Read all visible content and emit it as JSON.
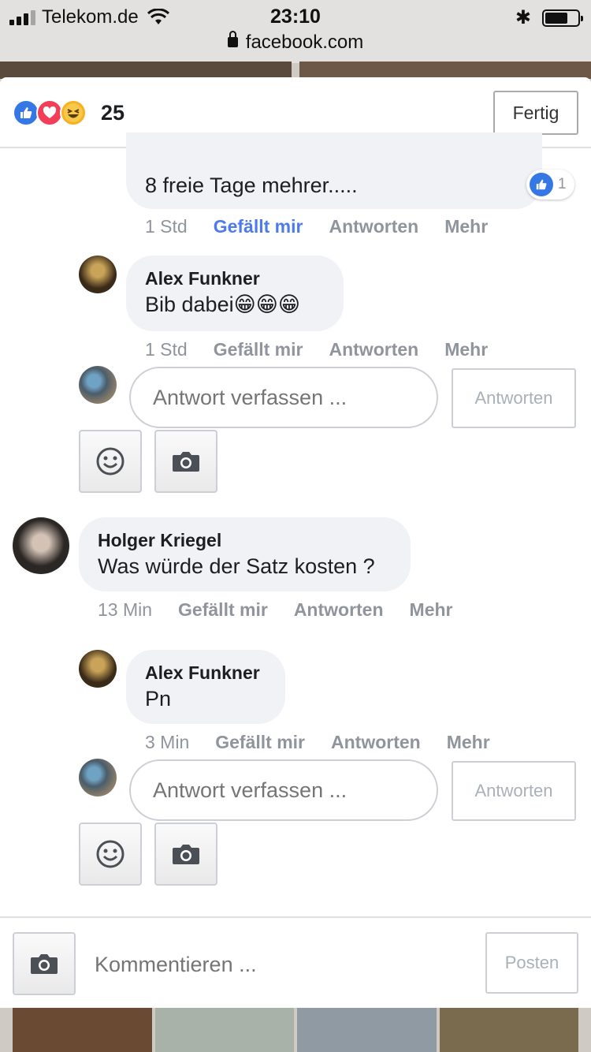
{
  "status_bar": {
    "carrier": "Telekom.de",
    "time": "23:10",
    "url": "facebook.com",
    "battery_level": 0.7
  },
  "header": {
    "reaction_icons": [
      "like-icon",
      "love-icon",
      "haha-icon"
    ],
    "reaction_count": "25",
    "done_label": "Fertig"
  },
  "comments": {
    "top_reply": {
      "text": "8 freie Tage mehrer.....",
      "like_count": "1",
      "time": "1 Std",
      "like_label": "Gefällt mir",
      "reply_label": "Antworten",
      "more_label": "Mehr"
    },
    "alex_reply_1": {
      "name": "Alex Funkner",
      "text": "Bib dabei😁😁😁",
      "time": "1 Std",
      "like_label": "Gefällt mir",
      "reply_label": "Antworten",
      "more_label": "Mehr"
    },
    "reply_box_1": {
      "placeholder": "Antwort verfassen ...",
      "button_label": "Antworten"
    },
    "holger": {
      "name": "Holger Kriegel",
      "text": "Was würde der Satz kosten ?",
      "time": "13 Min",
      "like_label": "Gefällt mir",
      "reply_label": "Antworten",
      "more_label": "Mehr"
    },
    "alex_reply_2": {
      "name": "Alex Funkner",
      "text": "Pn",
      "time": "3 Min",
      "like_label": "Gefällt mir",
      "reply_label": "Antworten",
      "more_label": "Mehr"
    },
    "reply_box_2": {
      "placeholder": "Antwort verfassen ...",
      "button_label": "Antworten"
    }
  },
  "footer": {
    "placeholder": "Kommentieren ...",
    "post_label": "Posten"
  },
  "colors": {
    "accent": "#4b7bec",
    "bubble": "#f0f2f5",
    "muted": "#90949c"
  }
}
